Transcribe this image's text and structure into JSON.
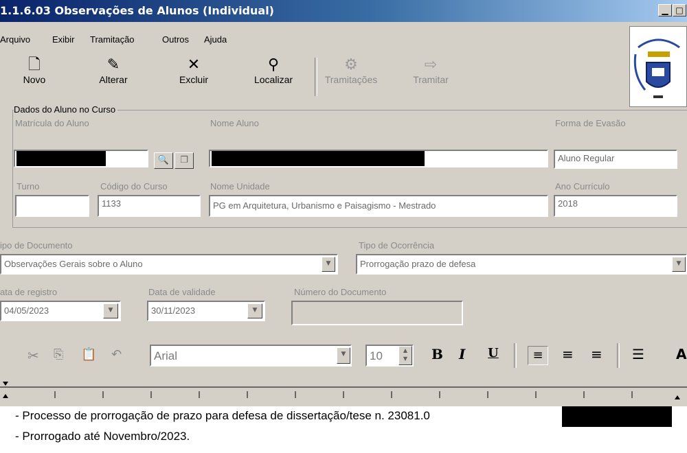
{
  "window": {
    "title": "1.1.6.03 Observações de Alunos (Individual)"
  },
  "menu": [
    "Arquivo",
    "Exibir",
    "Tramitação",
    "Outros",
    "Ajuda"
  ],
  "toolbar": [
    {
      "label": "Novo",
      "icon": "new-document-icon",
      "enabled": true
    },
    {
      "label": "Alterar",
      "icon": "edit-icon",
      "enabled": true
    },
    {
      "label": "Excluir",
      "icon": "delete-x-icon",
      "enabled": true
    },
    {
      "label": "Localizar",
      "icon": "binoculars-icon",
      "enabled": true
    },
    {
      "label": "Tramitações",
      "icon": "tramitacoes-icon",
      "enabled": false
    },
    {
      "label": "Tramitar",
      "icon": "tramitar-icon",
      "enabled": false
    }
  ],
  "aluno": {
    "group_title": "Dados do Aluno no Curso",
    "matricula_label": "Matrícula do Aluno",
    "nome_label": "Nome Aluno",
    "forma_label": "Forma de Evasão",
    "forma_value": "Aluno Regular",
    "turno_label": "Turno",
    "turno_value": "",
    "codigo_label": "Código do Curso",
    "codigo_value": "1133",
    "unidade_label": "Nome Unidade",
    "unidade_value": "PG em Arquitetura, Urbanismo e Paisagismo - Mestrado",
    "ano_label": "Ano Currículo",
    "ano_value": "2018"
  },
  "documento": {
    "tipo_doc_label": "ipo de Documento",
    "tipo_doc_value": "Observações Gerais sobre o Aluno",
    "tipo_oc_label": "Tipo de Ocorrência",
    "tipo_oc_value": "Prorrogação prazo de defesa",
    "data_reg_label": "ata de registro",
    "data_reg_value": "04/05/2023",
    "data_val_label": "Data de validade",
    "data_val_value": "30/11/2023",
    "num_doc_label": "Número do Documento",
    "num_doc_value": ""
  },
  "editor_toolbar": {
    "font": "Arial",
    "size": "10",
    "bold": "B",
    "italic": "I",
    "underline": "U"
  },
  "editor": {
    "line1": "- Processo de prorrogação de prazo para defesa de dissertação/tese n. 23081.0",
    "line2": "- Prorrogado até Novembro/2023."
  },
  "colors": {
    "titlebar": "#0a246a",
    "window": "#d4d0c8"
  }
}
